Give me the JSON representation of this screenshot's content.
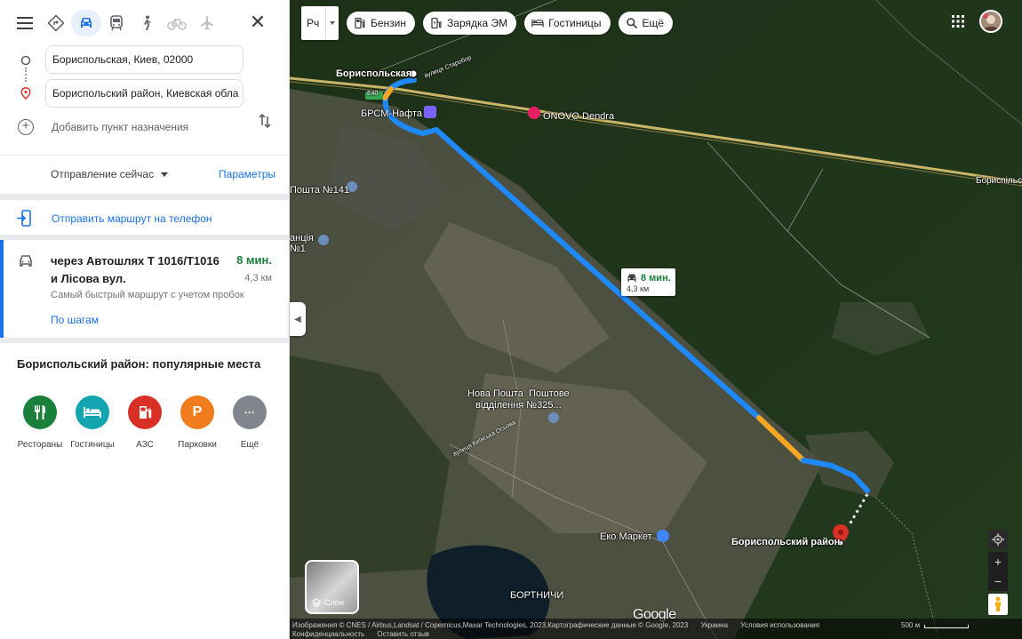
{
  "colors": {
    "accent": "#1a73e8",
    "time_green": "#188038",
    "route_blue": "#1e88ff",
    "traffic_orange": "#f5a623"
  },
  "travel_modes": [
    "directions-icon",
    "car-icon",
    "transit-icon",
    "walk-icon",
    "bike-icon",
    "flight-icon"
  ],
  "directions": {
    "origin": "Бориспольская, Киев, 02000",
    "destination": "Бориспольский район, Киевская обла",
    "add_destination": "Добавить пункт назначения"
  },
  "depart": {
    "label": "Отправление сейчас",
    "options_link": "Параметры"
  },
  "send_to_phone": "Отправить маршрут на телефон",
  "route": {
    "via": "через Автошлях Т 1016/T1016 и Лісова вул.",
    "time": "8 мин.",
    "distance": "4,3 км",
    "note": "Самый быстрый маршрут с учетом пробок",
    "steps_link": "По шагам"
  },
  "popular": {
    "title": "Бориспольский район: популярные места",
    "categories": [
      {
        "label": "Рестораны",
        "icon": "restaurant-icon",
        "color": "#188038"
      },
      {
        "label": "Гостиницы",
        "icon": "hotel-icon",
        "color": "#12a4af"
      },
      {
        "label": "АЗС",
        "icon": "gas-station-icon",
        "color": "#d93025"
      },
      {
        "label": "Парковки",
        "icon": "parking-icon",
        "color": "#f07c1b",
        "glyph": "P"
      },
      {
        "label": "Ещё",
        "icon": "more-icon",
        "color": "#80868b",
        "glyph": "···"
      }
    ]
  },
  "map": {
    "lang_toggle": "Рч",
    "chips": [
      "Бензин",
      "Зарядка ЭМ",
      "Гостиницы",
      "Ещё"
    ],
    "labels": {
      "origin_station": "Бориспольская",
      "street_small": "вулиця Старобор",
      "highway_shield": "E40",
      "gas_station": "БРСМ-Нафта",
      "hotel": "ONOVO Dendra",
      "post_141": "Пошта №141",
      "station_1": "анція\n№1",
      "nova_poshta": "Нова Пошта  Поштове\nвідділення №325...",
      "street_kyivsk": "вулиця Київська Осьова",
      "eco_market": "Еко Маркет",
      "destination": "Бориспольский район",
      "bortnychi": "БОРТНИЧИ",
      "boryspilska_road": "Бориспільсь"
    },
    "route_badge": {
      "time": "8 мин.",
      "distance": "4,3 км"
    },
    "layers_label": "Слои",
    "google": "Google",
    "footer": {
      "attribution": "Изображения © CNES / Airbus,Landsat / Copernicus,Maxar Technologies, 2023,Картографические данные © Google, 2023",
      "country": "Украина",
      "terms": "Условия использования",
      "privacy": "Конфиденциальность",
      "feedback": "Оставить отзыв",
      "scale": "500 м"
    }
  }
}
